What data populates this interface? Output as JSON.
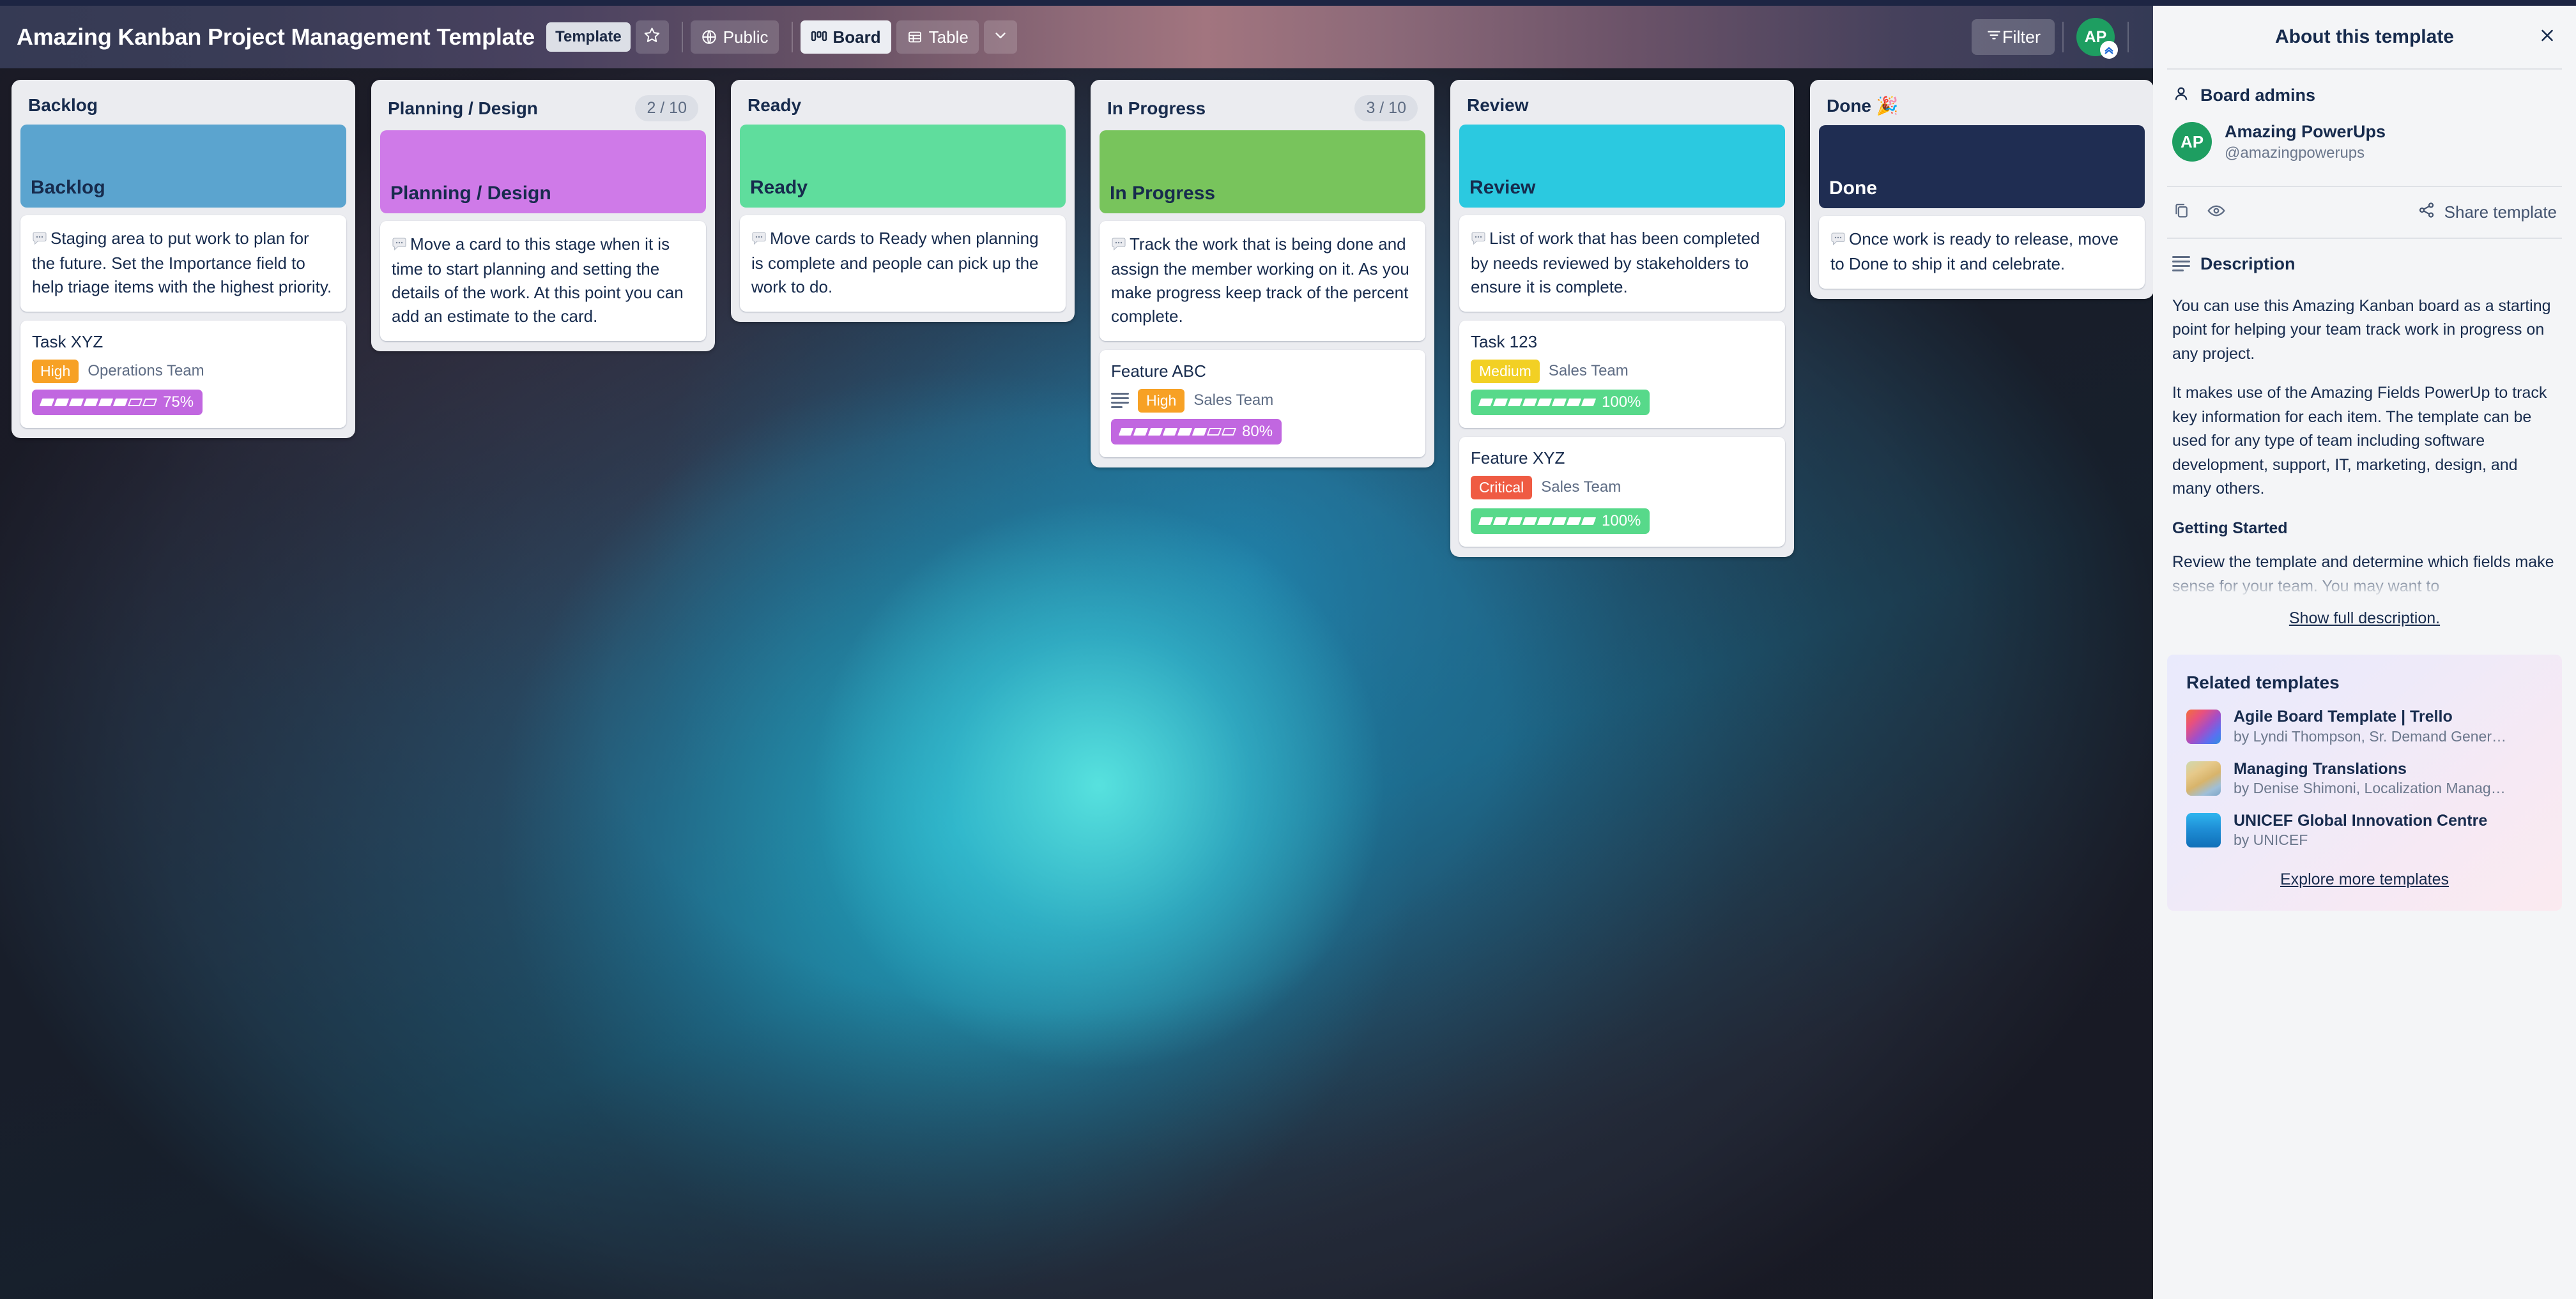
{
  "header": {
    "board_title": "Amazing Kanban Project Management Template",
    "template_badge": "Template",
    "star_icon": "star-icon",
    "visibility_label": "Public",
    "visibility_icon": "globe-icon",
    "view_board_label": "Board",
    "view_board_icon": "board-icon",
    "view_table_label": "Table",
    "view_table_icon": "table-icon",
    "more_views_icon": "chevron-down-icon",
    "filter_label": "Filter",
    "filter_icon": "filter-icon",
    "avatar_initials": "AP",
    "avatar_badge_icon": "chevron-up-badge-icon",
    "gradient_left": "#353a54",
    "gradient_mid": "#a2757f",
    "gradient_right": "#343a55"
  },
  "board": {
    "columns": [
      {
        "title": "Backlog",
        "count": "",
        "banner_label": "Backlog",
        "banner_color": "#5ba4cf",
        "banner_text_color": "#172b4d",
        "description": "Staging area to put work to plan for the future. Set the Importance field to help triage items with the highest priority.",
        "cards": [
          {
            "title": "Task XYZ",
            "has_desc_icon": false,
            "priority": "High",
            "priority_color": "#f7a125",
            "team": "Operations Team",
            "progress_text": "75%",
            "progress_value": 75,
            "progress_color": "#c167e0",
            "inline_progress": false
          }
        ]
      },
      {
        "title": "Planning / Design",
        "count": "2 / 10",
        "banner_label": "Planning / Design",
        "banner_color": "#cf7ae8",
        "banner_text_color": "#172b4d",
        "description": "Move a card to this stage when it is time to start planning and setting the details of the work. At this point you can add an estimate to the card.",
        "cards": []
      },
      {
        "title": "Ready",
        "count": "",
        "banner_label": "Ready",
        "banner_color": "#5fdd9d",
        "banner_text_color": "#172b4d",
        "description": "Move cards to Ready when planning is complete and people can pick up the work to do.",
        "cards": []
      },
      {
        "title": "In Progress",
        "count": "3 / 10",
        "banner_label": "In Progress",
        "banner_color": "#78c45c",
        "banner_text_color": "#172b4d",
        "description": "Track the work that is being done and assign the member working on it. As you make progress keep track of the percent complete.",
        "cards": [
          {
            "title": "Feature ABC",
            "has_desc_icon": true,
            "priority": "High",
            "priority_color": "#f7a125",
            "team": "Sales Team",
            "progress_text": "80%",
            "progress_value": 80,
            "progress_color": "#c167e0",
            "inline_progress": false
          }
        ]
      },
      {
        "title": "Review",
        "count": "",
        "banner_label": "Review",
        "banner_color": "#2bc9e0",
        "banner_text_color": "#172b4d",
        "description": "List of work that has been completed by needs reviewed by stakeholders to ensure it is complete.",
        "cards": [
          {
            "title": "Task 123",
            "has_desc_icon": false,
            "priority": "Medium",
            "priority_color": "#f2d024",
            "team": "Sales Team",
            "progress_text": "100%",
            "progress_value": 100,
            "progress_color": "#57d98a",
            "inline_progress": false
          },
          {
            "title": "Feature XYZ",
            "has_desc_icon": false,
            "priority": "Critical",
            "priority_color": "#ef5b43",
            "team": "Sales Team",
            "progress_text": "100%",
            "progress_value": 100,
            "progress_color": "#57d98a",
            "inline_progress": true
          }
        ]
      },
      {
        "title": "Done 🎉",
        "count": "",
        "banner_label": "Done",
        "banner_color": "#1f2d52",
        "banner_text_color": "#ffffff",
        "description": "Once work is ready to release, move to Done to ship it and celebrate.",
        "cards": []
      }
    ]
  },
  "sidebar": {
    "title": "About this template",
    "close_icon": "close-icon",
    "admins": {
      "section_title": "Board admins",
      "person_icon": "person-icon",
      "avatar_initials": "AP",
      "name": "Amazing PowerUps",
      "handle": "@amazingpowerups"
    },
    "actions": {
      "copy_icon": "copy-icon",
      "views_icon": "eye-icon",
      "share_icon": "share-icon",
      "share_label": "Share template"
    },
    "description": {
      "section_title": "Description",
      "list_icon": "description-lines-icon",
      "paragraph1": "You can use this Amazing Kanban board as a starting point for helping your team track work in progress on any project.",
      "paragraph2": "It makes use of the Amazing Fields PowerUp to track key information for each item. The template can be used for any type of team including software development, support, IT, marketing, design, and many others.",
      "heading1": "Getting Started",
      "paragraph3": "Review the template and determine which fields make sense for your team. You may want to",
      "show_full_label": "Show full description."
    },
    "related": {
      "title": "Related templates",
      "items": [
        {
          "name": "Agile Board Template | Trello",
          "by": "by Lyndi Thompson, Sr. Demand Gener…",
          "thumb": "t1"
        },
        {
          "name": "Managing Translations",
          "by": "by Denise Shimoni, Localization Manag…",
          "thumb": "t2"
        },
        {
          "name": "UNICEF Global Innovation Centre",
          "by": "by UNICEF",
          "thumb": "t3"
        }
      ],
      "explore_label": "Explore more templates"
    }
  }
}
